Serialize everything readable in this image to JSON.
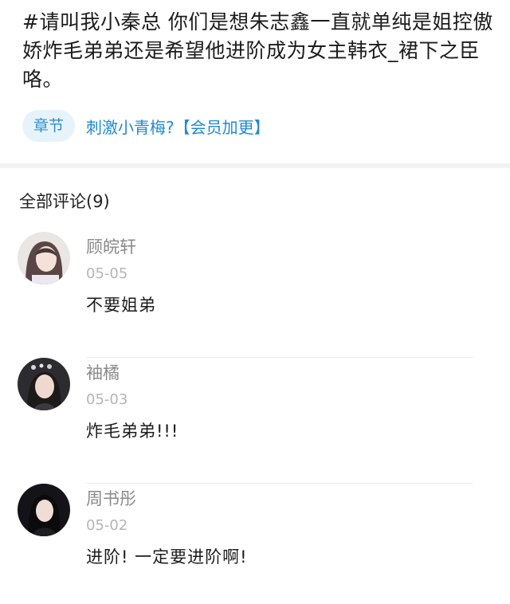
{
  "post": {
    "text": "#请叫我小秦总 你们是想朱志鑫一直就单纯是姐控傲娇炸毛弟弟还是希望他进阶成为女主韩衣_裙下之臣咯。",
    "chapter_tag": "章节",
    "chapter_link": "刺激小青梅?【会员加更】"
  },
  "comments_header": "全部评论(9)",
  "comments": [
    {
      "name": "顾皖轩",
      "date": "05-05",
      "body": "不要姐弟"
    },
    {
      "name": "袖橘",
      "date": "05-03",
      "body": "炸毛弟弟!!!"
    },
    {
      "name": "周书彤",
      "date": "05-02",
      "body": "进阶! 一定要进阶啊!"
    }
  ],
  "colors": {
    "link": "#1f8ad2",
    "tag_bg": "#e7f3fb",
    "meta": "#8a8a8a"
  }
}
